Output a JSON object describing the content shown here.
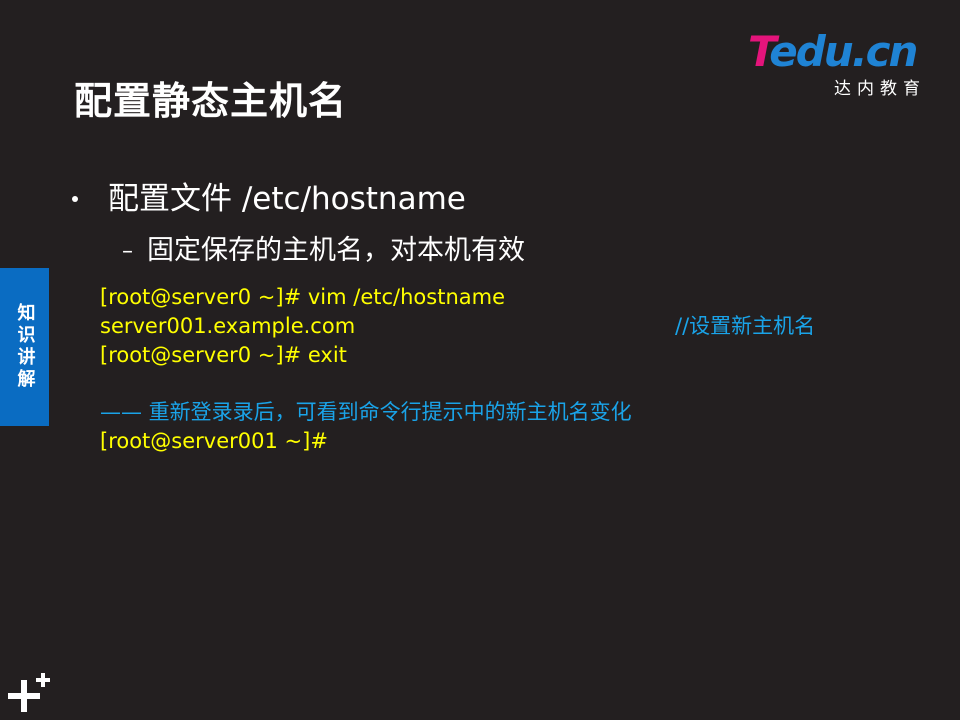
{
  "slide": {
    "title": "配置静态主机名",
    "logo": {
      "brand_first": "T",
      "brand_rest": "edu.cn",
      "subtitle": "达内教育"
    },
    "side_tab": "知识讲解",
    "bullet": "配置文件 /etc/hostname",
    "sub_bullet": "固定保存的主机名，对本机有效",
    "code": {
      "line1": "[root@server0 ~]# vim  /etc/hostname",
      "line2": "server001.example.com",
      "line2_comment": "//设置新主机名",
      "line3": "[root@server0 ~]# exit",
      "note": "—— 重新登录录后，可看到命令行提示中的新主机名变化",
      "line4": "[root@server001 ~]#"
    },
    "colors": {
      "background": "#231f20",
      "code_text": "#ffff00",
      "comment_text": "#1aa3e8",
      "side_tab": "#0a6cc2",
      "logo_pink": "#e4147b",
      "logo_blue": "#1f83d4"
    },
    "icons": {
      "footer": "plus-icon"
    }
  }
}
